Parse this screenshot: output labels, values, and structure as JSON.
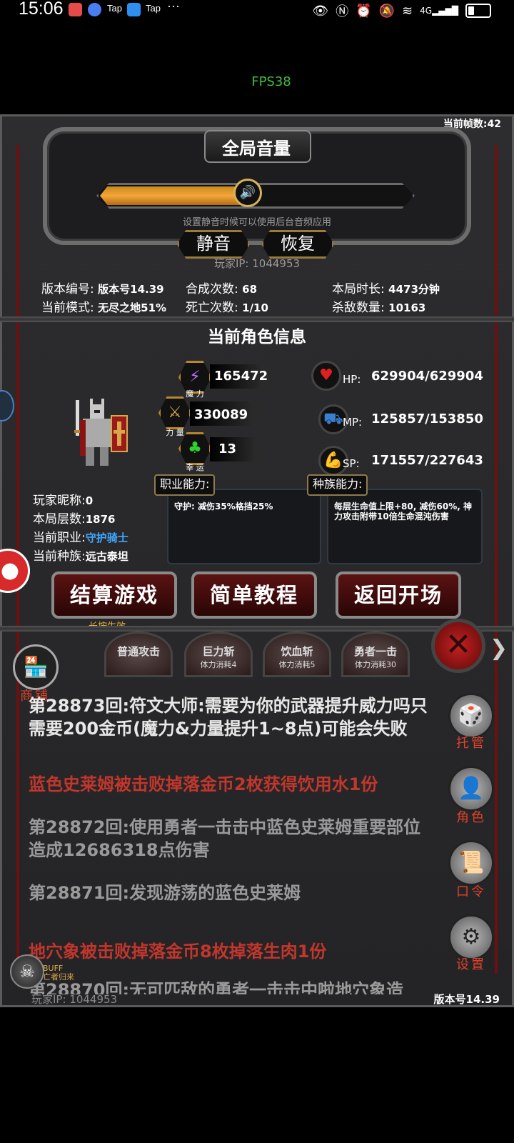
{
  "status": {
    "time": "15:06",
    "tap1": "Tap",
    "tap2": "Tap",
    "more": "···",
    "network": "4G"
  },
  "fps": "FPS38",
  "frame_count": "当前帧数:42",
  "volume": {
    "title": "全局音量",
    "level_fraction": 0.47,
    "hint": "设置静音时候可以使用后台音频应用",
    "mute_label": "静音",
    "restore_label": "恢复"
  },
  "player_ip_top": "玩家IP:  1044953",
  "stats": {
    "version_label": "版本编号:",
    "version_value": "版本号14.39",
    "synth_label": "合成次数:",
    "synth_value": "68",
    "duration_label": "本局时长:",
    "duration_value": "4473分钟",
    "mode_label": "当前模式:",
    "mode_value": "无尽之地51%",
    "death_label": "死亡次数:",
    "death_value": "1/10",
    "kills_label": "杀敌数量:",
    "kills_value": "10163"
  },
  "character": {
    "section_title": "当前角色信息",
    "magic_value": "165472",
    "magic_label": "魔 力",
    "strength_value": "330089",
    "strength_label": "力 量",
    "luck_value": "13",
    "luck_label": "幸 运",
    "hp_label": "HP:",
    "hp_value": "629904/629904",
    "mp_label": "MP:",
    "mp_value": "125857/153850",
    "sp_label": "SP:",
    "sp_value": "171557/227643",
    "nick_label": "玩家昵称:",
    "nick_value": "0",
    "floor_label": "本局层数:",
    "floor_value": "1876",
    "job_label": "当前职业:",
    "job_value": "守护骑士",
    "race_label": "当前种族:",
    "race_value": "远古泰坦",
    "job_ability_tag": "职业能力:",
    "job_ability_text": "守护:  减伤35%格挡25%",
    "race_ability_tag": "种族能力:",
    "race_ability_text": "每层生命值上限+80, 减伤60%, 神力攻击附带10倍生命混沌伤害"
  },
  "buttons": {
    "settle": "结算游戏",
    "settle_hint": "长按生效",
    "tutorial": "简单教程",
    "back": "返回开场"
  },
  "skills": [
    {
      "name": "普通攻击",
      "cost": ""
    },
    {
      "name": "巨力斩",
      "cost": "体力消耗4"
    },
    {
      "name": "饮血斩",
      "cost": "体力消耗5"
    },
    {
      "name": "勇者一击",
      "cost": "体力消耗30"
    }
  ],
  "side_menu": {
    "shop": "商铺",
    "auto": "托管",
    "role": "角色",
    "command": "口令",
    "settings": "设置"
  },
  "log": [
    "第28873回:符文大师:需要为你的武器提升威力吗只需要200金币(魔力&力量提升1~8点)可能会失败",
    "蓝色史莱姆被击败掉落金币2枚获得饮用水1份",
    "第28872回:使用勇者一击击中蓝色史莱姆重要部位造成12686318点伤害",
    "第28871回:发现游荡的蓝色史莱姆",
    "地穴象被击败掉落金币8枚掉落生肉1份",
    "第28870回:无可匹敌的勇者一击击中啦地穴象造"
  ],
  "buff": {
    "label": "BUFF",
    "sub": "亡者归来"
  },
  "player_ip_bottom": "玩家IP:  1044953",
  "version_bottom": "版本号14.39",
  "colors": {
    "accent_gold": "#f2a63a",
    "log_red": "#c2362c",
    "job_blue": "#3fa9ff",
    "fps_green": "#3fbf3f"
  },
  "icons": [
    "eye-icon",
    "nfc-icon",
    "alarm-icon",
    "mute-icon",
    "wifi-icon",
    "signal-icon",
    "battery-icon",
    "speaker-icon",
    "lightning-icon",
    "sword-icon",
    "clover-icon",
    "heart-icon",
    "car-icon",
    "strongman-icon",
    "knight-icon",
    "close-icon",
    "dice-icon",
    "hood-icon",
    "book-icon",
    "gear-icon",
    "skull-icon",
    "shop-icon",
    "user-icon"
  ]
}
